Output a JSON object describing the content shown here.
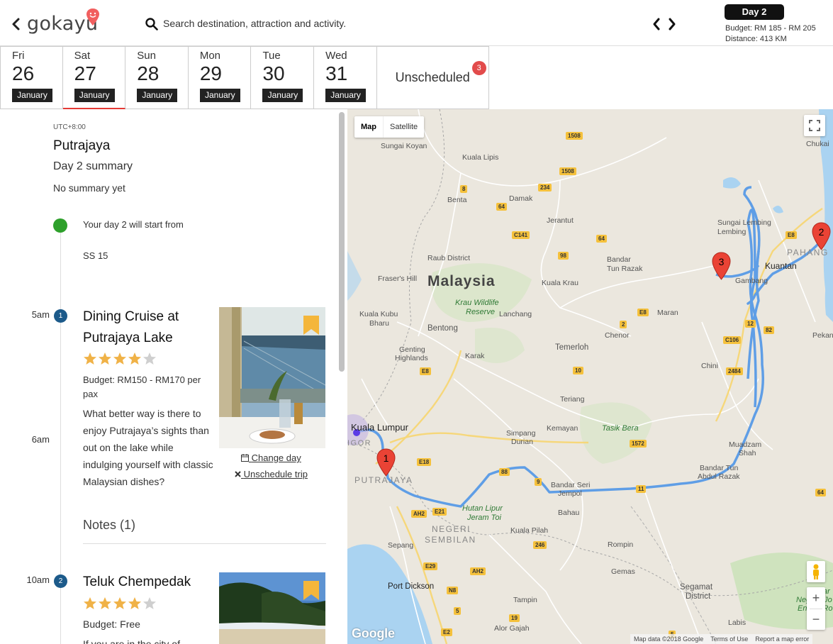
{
  "header": {
    "logo": "gokayu",
    "search_placeholder": "Search destination, attraction and activity.",
    "day_pill": "Day 2",
    "budget": "Budget: RM 185 - RM 205",
    "distance": "Distance: 413 KM"
  },
  "dates": [
    {
      "dow": "Fri",
      "num": "26",
      "month": "January"
    },
    {
      "dow": "Sat",
      "num": "27",
      "month": "January"
    },
    {
      "dow": "Sun",
      "num": "28",
      "month": "January"
    },
    {
      "dow": "Mon",
      "num": "29",
      "month": "January"
    },
    {
      "dow": "Tue",
      "num": "30",
      "month": "January"
    },
    {
      "dow": "Wed",
      "num": "31",
      "month": "January"
    }
  ],
  "unscheduled": {
    "label": "Unscheduled",
    "count": "3"
  },
  "day": {
    "timezone": "UTC+8:00",
    "city": "Putrajaya",
    "summary_title": "Day 2 summary",
    "summary_text": "No summary yet",
    "start_text": "Your day 2 will start from",
    "start_place": "SS 15"
  },
  "activities": [
    {
      "time": "5am",
      "number": "1",
      "title": "Dining Cruise at Putrajaya Lake",
      "rating": 4,
      "budget": "Budget: RM150 - RM170 per pax",
      "description": "What better way is there to enjoy Putrajaya’s sights than out on the lake while indulging yourself with classic Malaysian dishes?",
      "change_day": "Change day",
      "unschedule": "Unschedule trip",
      "notes": "Notes (1)"
    },
    {
      "time": "10am",
      "number": "2",
      "title": "Teluk Chempedak",
      "rating": 4,
      "budget": "Budget: Free",
      "description": "If you are in the city of"
    }
  ],
  "time_marks": {
    "six": "6am"
  },
  "map": {
    "type_map": "Map",
    "type_satellite": "Satellite",
    "zoom_in": "+",
    "zoom_out": "−",
    "google": "Google",
    "footer": [
      "Map data ©2018 Google",
      "Terms of Use",
      "Report a map error"
    ],
    "labels": {
      "malaysia": "Malaysia",
      "kuala_lumpur": "Kuala Lumpur",
      "putrajaya": "PUTRAJAYA",
      "negeri": "NEGERI",
      "sembilan": "SEMBILAN",
      "pahang": "PAHANG",
      "kuantan": "Kuantan",
      "gambang": "Gambang",
      "sungai_koyan": "Sungai Koyan",
      "kuala_lipis": "Kuala Lipis",
      "chukai": "Chukai",
      "benta": "Benta",
      "damak": "Damak",
      "jerantut": "Jerantut",
      "sungai_lembing": "Sungai Lembing",
      "lembing": "Lembing",
      "raub": "Raub District",
      "bandar_tun": "Bandar",
      "tun_razak": "Tun Razak",
      "fraser": "Fraser's Hill",
      "kuala_krau": "Kuala Krau",
      "krau": "Krau Wildlife",
      "reserve": "Reserve",
      "maran": "Maran",
      "kuala_kubu": "Kuala Kubu",
      "bharu": "Bharu",
      "bentong": "Bentong",
      "lanchang": "Lanchang",
      "chenor": "Chenor",
      "genting": "Genting",
      "highlands": "Highlands",
      "karak": "Karak",
      "temerloh": "Temerloh",
      "chini": "Chini",
      "pekan": "Pekan",
      "teriang": "Teriang",
      "simpang": "Simpang",
      "durian": "Durian",
      "kemayan": "Kemayan",
      "tasik_bera": "Tasik Bera",
      "muadzam": "Muadzam",
      "shah": "Shah",
      "bandar_tun2": "Bandar Tun",
      "abdul_razak": "Abdul Razak",
      "bandar_seri": "Bandar Seri",
      "jempol": "Jempol",
      "hutan": "Hutan Lipur",
      "jeram": "Jeram Toi",
      "bahau": "Bahau",
      "kuala_pilah": "Kuala Pilah",
      "sepang": "Sepang",
      "rompin": "Rompin",
      "gemas": "Gemas",
      "port_dickson": "Port Dickson",
      "segamat": "Segamat",
      "district": "District",
      "tampin": "Tampin",
      "tamar": "Tamar",
      "negara": "Negara Jo",
      "endau": "Endau-Ro",
      "alor_gajah": "Alor Gajah",
      "labis": "Labis",
      "igor": "IGOR"
    },
    "shields": [
      "1508",
      "1508",
      "234",
      "8",
      "64",
      "C141",
      "98",
      "64",
      "E8",
      "E8",
      "12",
      "82",
      "2",
      "C106",
      "E8",
      "10",
      "2484",
      "1572",
      "E18",
      "88",
      "9",
      "11",
      "AH2",
      "E21",
      "246",
      "E29",
      "AH2",
      "N8",
      "5",
      "E2",
      "19",
      "5",
      "64"
    ],
    "markers": [
      "1",
      "2",
      "3"
    ]
  }
}
